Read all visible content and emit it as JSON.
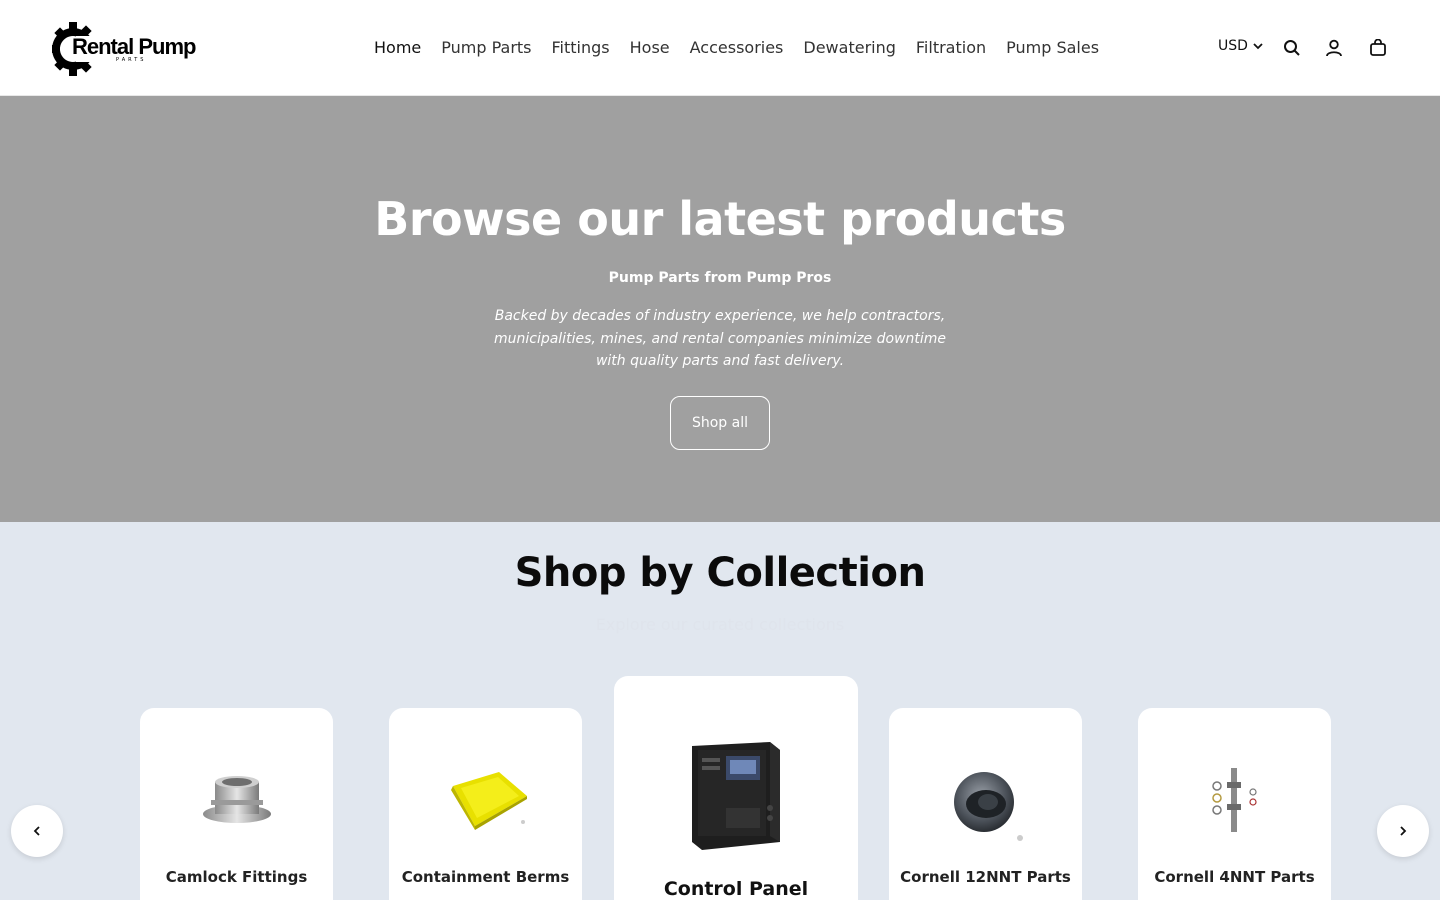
{
  "brand": {
    "name": "Rental Pump",
    "sub": "PARTS"
  },
  "nav": {
    "items": [
      {
        "label": "Home",
        "active": true
      },
      {
        "label": "Pump Parts"
      },
      {
        "label": "Fittings"
      },
      {
        "label": "Hose"
      },
      {
        "label": "Accessories"
      },
      {
        "label": "Dewatering"
      },
      {
        "label": "Filtration"
      },
      {
        "label": "Pump Sales"
      }
    ]
  },
  "header": {
    "currency": "USD",
    "icons": [
      "search-icon",
      "account-icon",
      "cart-icon"
    ]
  },
  "hero": {
    "title": "Browse our latest products",
    "subtitle": "Pump Parts from Pump Pros",
    "description": "Backed by decades of industry experience, we help contractors, municipalities, mines, and rental companies minimize downtime with quality parts and fast delivery.",
    "button": "Shop all",
    "background": "#a0a0a0"
  },
  "collection": {
    "title": "Shop by Collection",
    "subtitle": "Explore our curated collections",
    "cards": [
      {
        "title": "Camlock Fittings",
        "image": "camlock-fitting-image"
      },
      {
        "title": "Containment Berms",
        "image": "containment-berm-image"
      },
      {
        "title": "Control Panel",
        "image": "control-panel-image",
        "featured": true
      },
      {
        "title": "Cornell 12NNT Parts",
        "image": "cornell-12nnt-image"
      },
      {
        "title": "Cornell 4NNT Parts",
        "image": "cornell-4nnt-image"
      }
    ],
    "background": "#e1e7ef"
  },
  "carousel": {
    "prev_icon": "chevron-left-icon",
    "next_icon": "chevron-right-icon"
  }
}
